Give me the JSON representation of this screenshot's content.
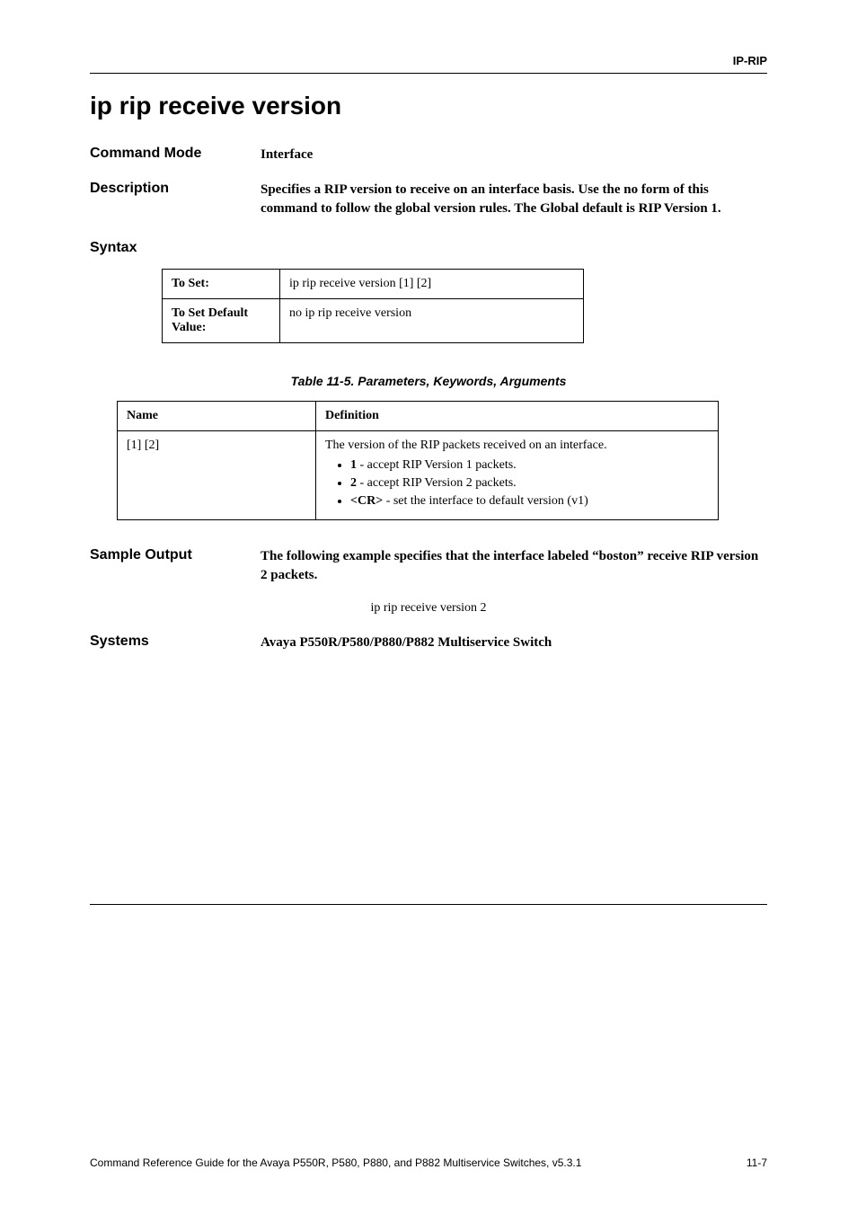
{
  "header_tag": "IP-RIP",
  "title": "ip rip receive version",
  "sections": {
    "command_mode": {
      "label": "Command Mode",
      "value": "Interface"
    },
    "description": {
      "label": "Description",
      "value": "Specifies a RIP version to receive on an interface basis. Use the no form of this command to follow the global version rules. The Global default is RIP Version 1."
    },
    "syntax": {
      "label": "Syntax"
    },
    "sample_output": {
      "label": "Sample Output",
      "value": "The following example specifies that the interface labeled “boston” receive RIP version 2 packets."
    },
    "systems": {
      "label": "Systems",
      "value": "Avaya P550R/P580/P880/P882 Multiservice Switch"
    }
  },
  "syntax_table": {
    "rows": [
      {
        "label": "To Set:",
        "value": "ip rip receive version [1] [2]"
      },
      {
        "label": "To Set Default Value:",
        "value": "no ip rip receive version"
      }
    ]
  },
  "param_table": {
    "caption": "Table 11-5.  Parameters, Keywords, Arguments",
    "headers": {
      "name": "Name",
      "definition": "Definition"
    },
    "row": {
      "name": "[1] [2]",
      "definition_intro": "The version of the RIP packets received on an interface.",
      "bullets": [
        {
          "bold": "1",
          "rest": " - accept RIP Version 1 packets."
        },
        {
          "bold": "2",
          "rest": " - accept RIP Version 2 packets."
        },
        {
          "bold": "<CR>",
          "rest": " - set the interface to default version (v1)"
        }
      ]
    }
  },
  "sample_command": "ip rip receive version 2",
  "footer": {
    "left": "Command Reference Guide for the Avaya P550R, P580, P880, and P882 Multiservice Switches, v5.3.1",
    "right": "11-7"
  }
}
